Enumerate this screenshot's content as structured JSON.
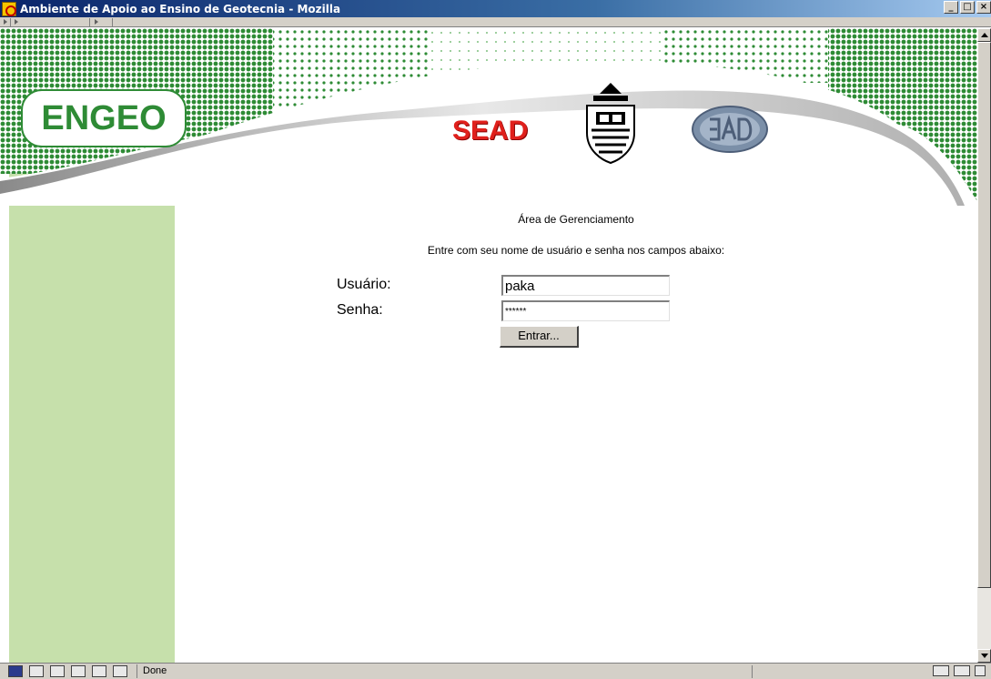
{
  "window": {
    "title": "Ambiente de Apoio ao Ensino de Geotecnia - Mozilla",
    "minimize": "_",
    "maximize": "□",
    "close": "×"
  },
  "banner": {
    "logo_text": "ENGEO",
    "sead_text": "SEAD",
    "brand_green": "#2e8b35",
    "sidebar_green": "#c6e0ab"
  },
  "login": {
    "heading": "Área de Gerenciamento",
    "instructions": "Entre com seu nome de usuário e senha nos campos abaixo:",
    "user_label": "Usuário:",
    "pass_label": "Senha:",
    "user_value": "paka",
    "pass_value": "******",
    "submit_label": "Entrar..."
  },
  "statusbar": {
    "text": "Done",
    "icons": [
      "navigator-icon",
      "mail-icon",
      "composer-icon",
      "addressbook-icon",
      "chat-icon",
      "edit-icon"
    ],
    "right_icons": [
      "online-icon",
      "security-icon",
      "lock-icon"
    ]
  }
}
